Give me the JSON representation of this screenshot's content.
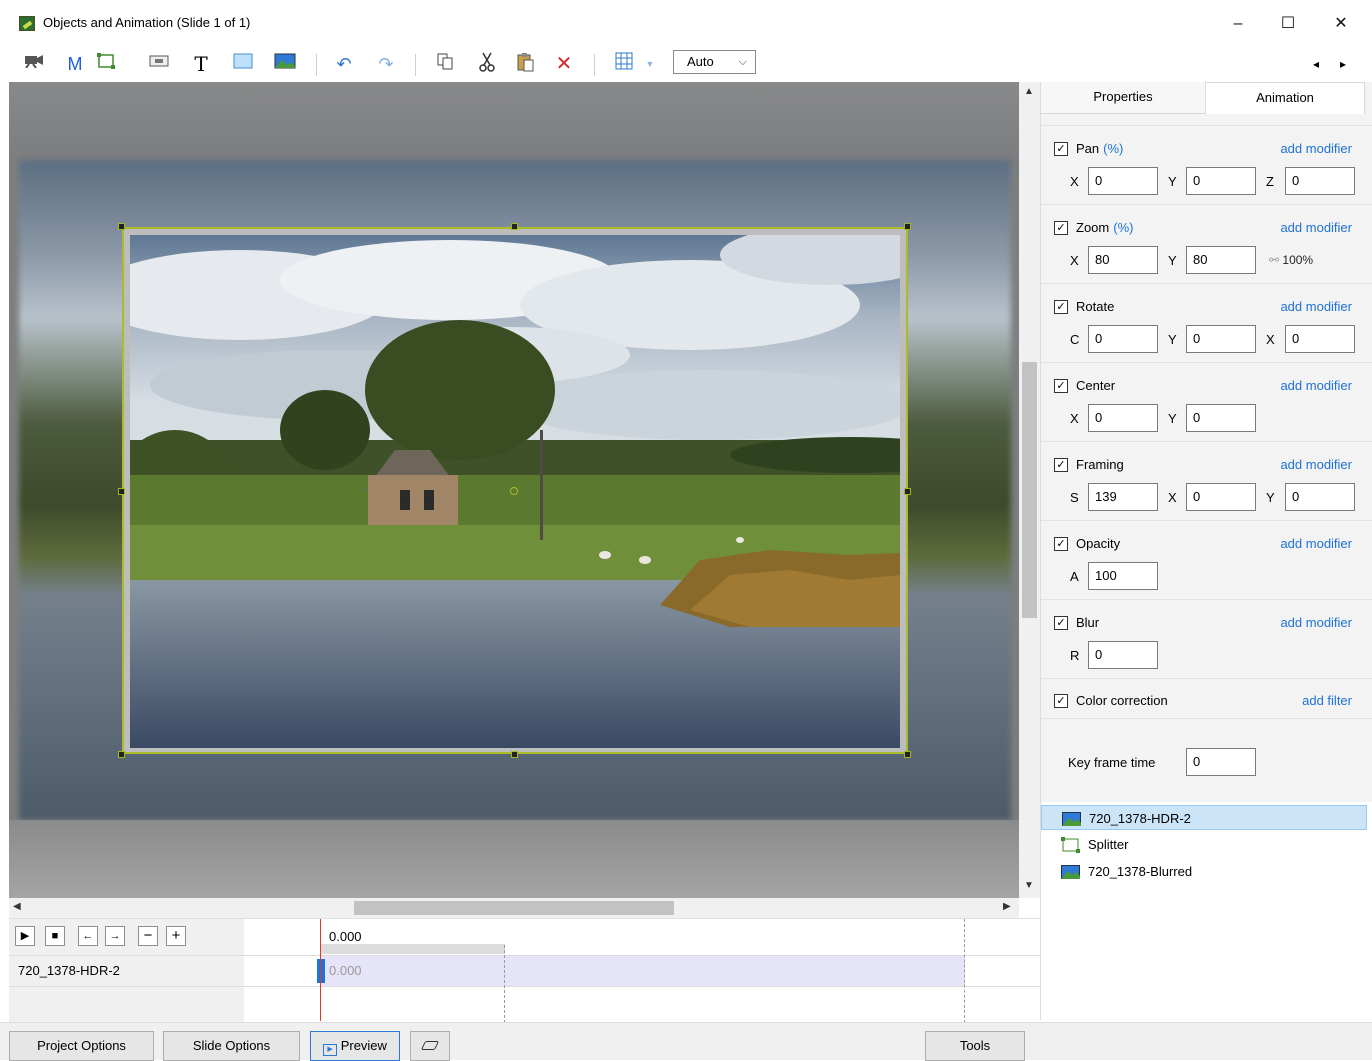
{
  "window": {
    "title": "Objects and Animation (Slide 1 of 1)",
    "minimize_glyph": "–",
    "maximize_glyph": "☐",
    "close_glyph": "✕"
  },
  "toolbar": {
    "m_label": "M",
    "t_label": "T",
    "auto_value": "Auto",
    "nav_prev": "◂",
    "nav_next": "▸"
  },
  "icons": [
    "camera-icon",
    "mask-icon",
    "frame-icon",
    "button-icon",
    "text-icon",
    "rectangle-icon",
    "image-icon",
    "undo-icon",
    "redo-icon",
    "copy-icon",
    "cut-icon",
    "paste-icon",
    "delete-icon",
    "grid-icon",
    "grid-dropdown-icon"
  ],
  "tabs": {
    "properties": "Properties",
    "animation": "Animation"
  },
  "props": {
    "add_modifier": "add modifier",
    "add_filter": "add filter",
    "pct": "(%)",
    "pan": {
      "label": "Pan",
      "x_label": "X",
      "x": "0",
      "y_label": "Y",
      "y": "0",
      "z_label": "Z",
      "z": "0"
    },
    "zoom": {
      "label": "Zoom",
      "x_label": "X",
      "x": "80",
      "y_label": "Y",
      "y": "80",
      "link_value": "100%"
    },
    "rotate": {
      "label": "Rotate",
      "c_label": "C",
      "c": "0",
      "y_label": "Y",
      "y": "0",
      "x_label": "X",
      "x": "0"
    },
    "center": {
      "label": "Center",
      "x_label": "X",
      "x": "0",
      "y_label": "Y",
      "y": "0"
    },
    "framing": {
      "label": "Framing",
      "s_label": "S",
      "s": "139",
      "x_label": "X",
      "x": "0",
      "y_label": "Y",
      "y": "0"
    },
    "opacity": {
      "label": "Opacity",
      "a_label": "A",
      "a": "100"
    },
    "blur": {
      "label": "Blur",
      "r_label": "R",
      "r": "0"
    },
    "color": {
      "label": "Color correction"
    },
    "keyframe": {
      "label": "Key frame time",
      "value": "0"
    }
  },
  "objects": [
    {
      "name": "720_1378-HDR-2",
      "selected": true
    },
    {
      "name": "Splitter",
      "selected": false
    },
    {
      "name": "720_1378-Blurred",
      "selected": false
    }
  ],
  "timeline": {
    "time": "0.000",
    "track_name": "720_1378-HDR-2",
    "track_time": "0.000"
  },
  "bottom": {
    "project_options": "Project Options",
    "slide_options": "Slide Options",
    "preview": "Preview",
    "tools": "Tools"
  },
  "colors": {
    "accent": "#1f72d6",
    "selection": "#a8bd27",
    "playhead": "#e0392b"
  }
}
